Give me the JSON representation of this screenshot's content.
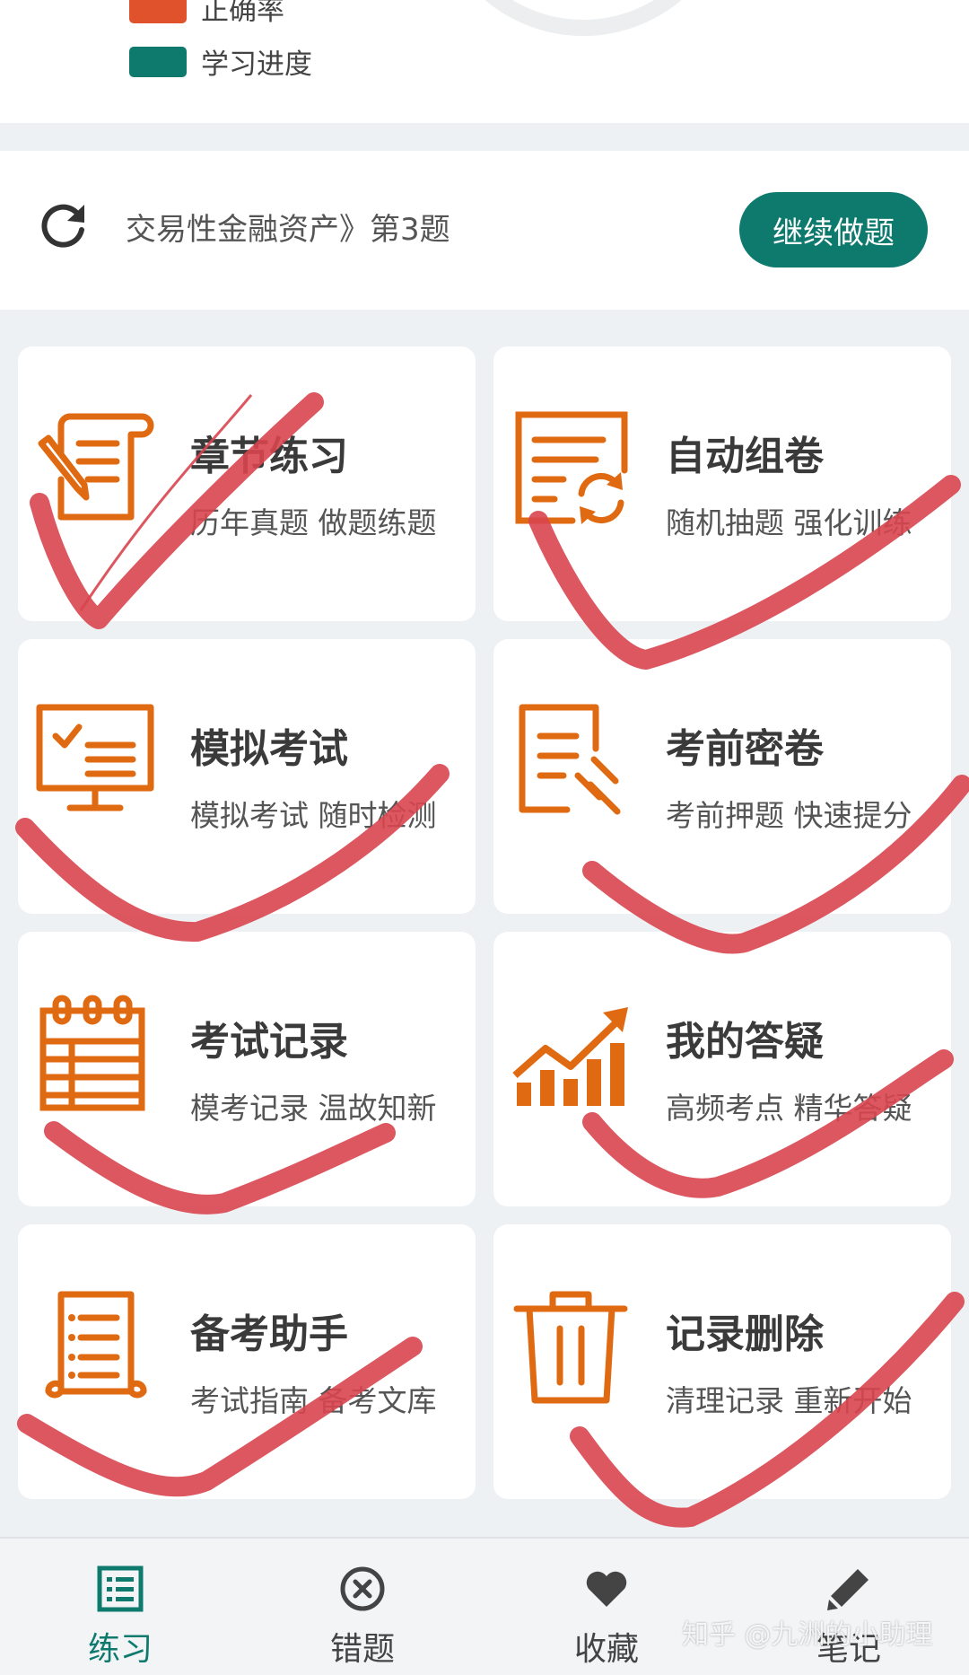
{
  "legend": {
    "items": [
      {
        "label": "正确率",
        "color": "#e0522c"
      },
      {
        "label": "学习进度",
        "color": "#0e7a6d"
      }
    ]
  },
  "resume": {
    "text": "交易性金融资产》第3题",
    "button_label": "继续做题"
  },
  "cards": [
    {
      "title": "章节练习",
      "subtitle": "历年真题 做题练题",
      "icon": "scroll-pencil-icon"
    },
    {
      "title": "自动组卷",
      "subtitle": "随机抽题 强化训练",
      "icon": "document-refresh-icon"
    },
    {
      "title": "模拟考试",
      "subtitle": "模拟考试 随时检测",
      "icon": "monitor-checklist-icon"
    },
    {
      "title": "考前密卷",
      "subtitle": "考前押题 快速提分",
      "icon": "document-gavel-icon"
    },
    {
      "title": "考试记录",
      "subtitle": "模考记录 温故知新",
      "icon": "calendar-icon"
    },
    {
      "title": "我的答疑",
      "subtitle": "高频考点 精华答疑",
      "icon": "trend-chart-icon"
    },
    {
      "title": "备考助手",
      "subtitle": "考试指南 备考文库",
      "icon": "scroll-list-icon"
    },
    {
      "title": "记录删除",
      "subtitle": "清理记录 重新开始",
      "icon": "trash-icon"
    }
  ],
  "tabs": [
    {
      "label": "练习",
      "icon": "list-icon",
      "active": true
    },
    {
      "label": "错题",
      "icon": "close-circle-icon",
      "active": false
    },
    {
      "label": "收藏",
      "icon": "heart-icon",
      "active": false
    },
    {
      "label": "笔记",
      "icon": "pen-icon",
      "active": false
    }
  ],
  "watermark": "知乎 @九洲的小助理",
  "colors": {
    "accent": "#0e7a6d",
    "icon_orange": "#e06a12",
    "annotation_red": "#d9454f"
  }
}
